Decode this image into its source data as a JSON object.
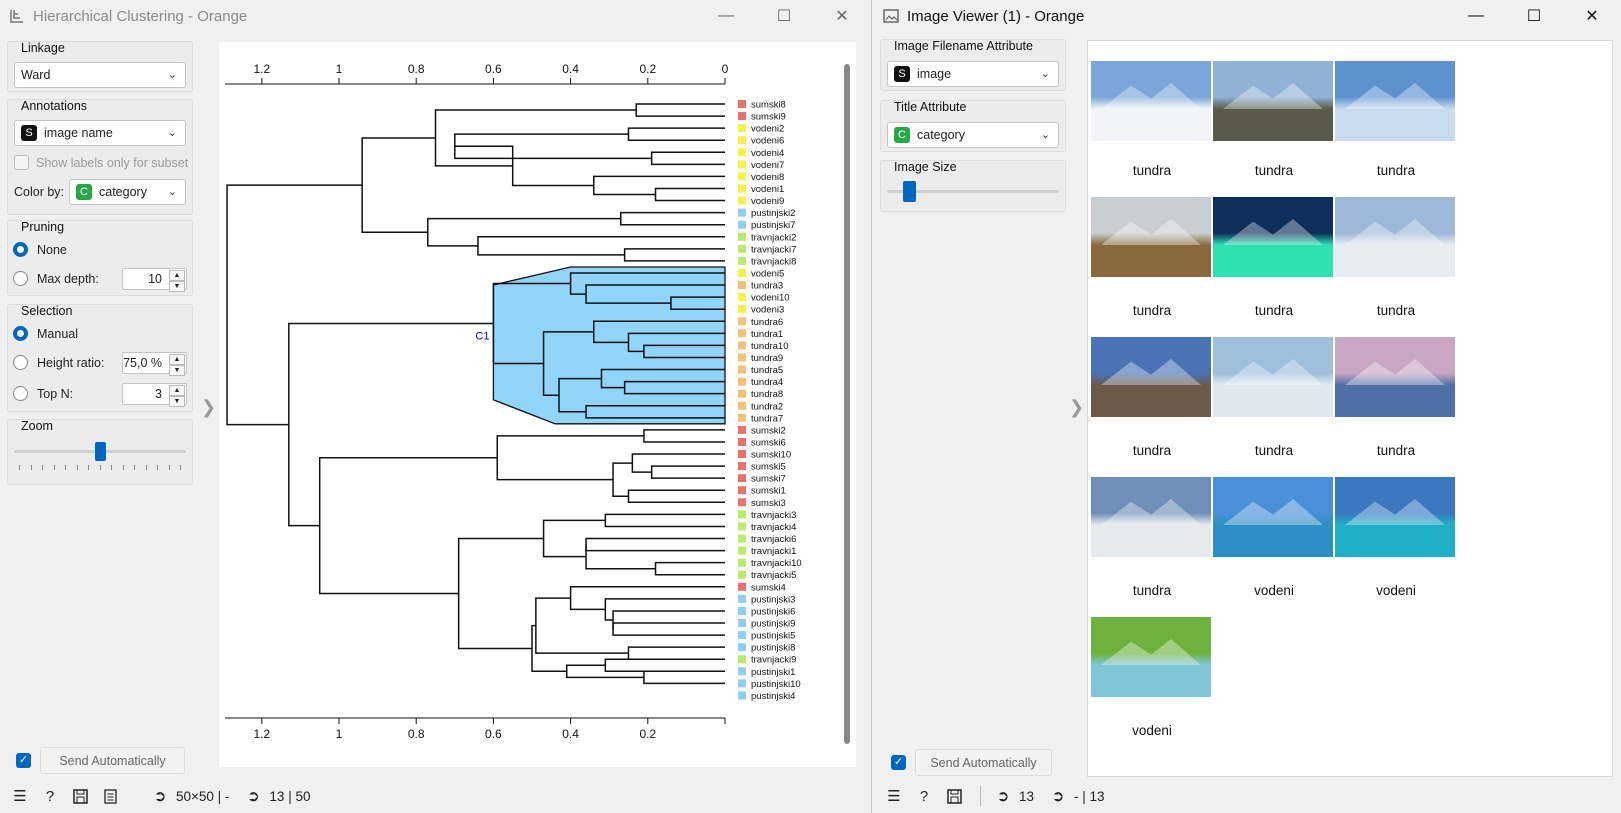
{
  "left_window": {
    "title": "Hierarchical Clustering - Orange",
    "linkage": {
      "label": "Linkage",
      "value": "Ward"
    },
    "annotations": {
      "label": "Annotations",
      "value": "image name",
      "badge": "S",
      "subset_label": "Show labels only for subset",
      "color_by_label": "Color by:",
      "color_by_value": "category",
      "color_badge": "C"
    },
    "pruning": {
      "label": "Pruning",
      "none_label": "None",
      "maxdepth_label": "Max depth:",
      "maxdepth_value": "10"
    },
    "selection": {
      "label": "Selection",
      "manual_label": "Manual",
      "height_label": "Height ratio:",
      "height_value": "75,0 %",
      "topn_label": "Top N:",
      "topn_value": "3"
    },
    "zoom": {
      "label": "Zoom",
      "level": 0.5
    },
    "send_label": "Send Automatically",
    "status": {
      "in": "50×50 | -",
      "out": "13 | 50"
    },
    "cluster_label": "C1",
    "axis_ticks": [
      "1.2",
      "1",
      "0.8",
      "0.6",
      "0.4",
      "0.2",
      "0"
    ],
    "axis_ticks_bottom": [
      "1.2",
      "1",
      "0.8",
      "0.6",
      "0.4",
      "0.2"
    ],
    "leaves": [
      {
        "name": "sumski8",
        "cat": "sumski"
      },
      {
        "name": "sumski9",
        "cat": "sumski"
      },
      {
        "name": "vodeni2",
        "cat": "vodeni"
      },
      {
        "name": "vodeni6",
        "cat": "vodeni"
      },
      {
        "name": "vodeni4",
        "cat": "vodeni"
      },
      {
        "name": "vodeni7",
        "cat": "vodeni"
      },
      {
        "name": "vodeni8",
        "cat": "vodeni"
      },
      {
        "name": "vodeni1",
        "cat": "vodeni"
      },
      {
        "name": "vodeni9",
        "cat": "vodeni"
      },
      {
        "name": "pustinjski2",
        "cat": "pustinjski"
      },
      {
        "name": "pustinjski7",
        "cat": "pustinjski"
      },
      {
        "name": "travnjacki2",
        "cat": "travnjacki"
      },
      {
        "name": "travnjacki7",
        "cat": "travnjacki"
      },
      {
        "name": "travnjacki8",
        "cat": "travnjacki"
      },
      {
        "name": "vodeni5",
        "cat": "vodeni"
      },
      {
        "name": "tundra3",
        "cat": "tundra"
      },
      {
        "name": "vodeni10",
        "cat": "vodeni"
      },
      {
        "name": "vodeni3",
        "cat": "vodeni"
      },
      {
        "name": "tundra6",
        "cat": "tundra"
      },
      {
        "name": "tundra1",
        "cat": "tundra"
      },
      {
        "name": "tundra10",
        "cat": "tundra"
      },
      {
        "name": "tundra9",
        "cat": "tundra"
      },
      {
        "name": "tundra5",
        "cat": "tundra"
      },
      {
        "name": "tundra4",
        "cat": "tundra"
      },
      {
        "name": "tundra8",
        "cat": "tundra"
      },
      {
        "name": "tundra2",
        "cat": "tundra"
      },
      {
        "name": "tundra7",
        "cat": "tundra"
      },
      {
        "name": "sumski2",
        "cat": "sumski"
      },
      {
        "name": "sumski6",
        "cat": "sumski"
      },
      {
        "name": "sumski10",
        "cat": "sumski"
      },
      {
        "name": "sumski5",
        "cat": "sumski"
      },
      {
        "name": "sumski7",
        "cat": "sumski"
      },
      {
        "name": "sumski1",
        "cat": "sumski"
      },
      {
        "name": "sumski3",
        "cat": "sumski"
      },
      {
        "name": "travnjacki3",
        "cat": "travnjacki"
      },
      {
        "name": "travnjacki4",
        "cat": "travnjacki"
      },
      {
        "name": "travnjacki6",
        "cat": "travnjacki"
      },
      {
        "name": "travnjacki1",
        "cat": "travnjacki"
      },
      {
        "name": "travnjacki10",
        "cat": "travnjacki"
      },
      {
        "name": "travnjacki5",
        "cat": "travnjacki"
      },
      {
        "name": "sumski4",
        "cat": "sumski"
      },
      {
        "name": "pustinjski3",
        "cat": "pustinjski"
      },
      {
        "name": "pustinjski6",
        "cat": "pustinjski"
      },
      {
        "name": "pustinjski9",
        "cat": "pustinjski"
      },
      {
        "name": "pustinjski5",
        "cat": "pustinjski"
      },
      {
        "name": "pustinjski8",
        "cat": "pustinjski"
      },
      {
        "name": "travnjacki9",
        "cat": "travnjacki"
      },
      {
        "name": "pustinjski1",
        "cat": "pustinjski"
      },
      {
        "name": "pustinjski10",
        "cat": "pustinjski"
      },
      {
        "name": "pustinjski4",
        "cat": "pustinjski"
      }
    ],
    "category_colors": {
      "sumski": "#e8716b",
      "vodeni": "#f5f24a",
      "pustinjski": "#8fcff5",
      "travnjacki": "#b8ec6a",
      "tundra": "#f5c07a"
    },
    "selection_color": "#91d5fb",
    "accent": "#0067c0"
  },
  "right_window": {
    "title": "Image Viewer (1) - Orange",
    "filename_attr": {
      "label": "Image Filename Attribute",
      "value": "image",
      "badge": "S"
    },
    "title_attr": {
      "label": "Title Attribute",
      "value": "category",
      "badge": "C"
    },
    "image_size": {
      "label": "Image Size",
      "level": 0.1
    },
    "send_label": "Send Automatically",
    "status": {
      "in": "13",
      "out": "- | 13"
    },
    "images": [
      {
        "caption": "tundra",
        "icon": "snowy-forest-image",
        "sky": "#7aa6d8",
        "ground": "#f2f4f8"
      },
      {
        "caption": "tundra",
        "icon": "tundra-plain-image",
        "sky": "#8fb2d6",
        "ground": "#5a5a4a"
      },
      {
        "caption": "tundra",
        "icon": "snow-dunes-image",
        "sky": "#5e92cf",
        "ground": "#c9dbef"
      },
      {
        "caption": "tundra",
        "icon": "autumn-valley-image",
        "sky": "#c9ced2",
        "ground": "#8a6a3c"
      },
      {
        "caption": "tundra",
        "icon": "aurora-image",
        "sky": "#0e2e5c",
        "ground": "#2de1b0"
      },
      {
        "caption": "tundra",
        "icon": "frozen-river-image",
        "sky": "#9db8d8",
        "ground": "#e7ecf2"
      },
      {
        "caption": "tundra",
        "icon": "mountain-range-image",
        "sky": "#4a73b5",
        "ground": "#6b5a4a"
      },
      {
        "caption": "tundra",
        "icon": "icy-plain-image",
        "sky": "#9ec0dc",
        "ground": "#dfe8ef"
      },
      {
        "caption": "tundra",
        "icon": "sunset-cliffs-image",
        "sky": "#c9a7c2",
        "ground": "#4f6fa8"
      },
      {
        "caption": "tundra",
        "icon": "snowfield-image",
        "sky": "#6f8fb8",
        "ground": "#e6eaef"
      },
      {
        "caption": "vodeni",
        "icon": "lake-image",
        "sky": "#4a90d8",
        "ground": "#2c8fc6"
      },
      {
        "caption": "vodeni",
        "icon": "mountain-lake-image",
        "sky": "#3a78c0",
        "ground": "#1fb0c8"
      },
      {
        "caption": "vodeni",
        "icon": "ducks-lake-image",
        "sky": "#6db23c",
        "ground": "#7fc7d8"
      }
    ]
  }
}
